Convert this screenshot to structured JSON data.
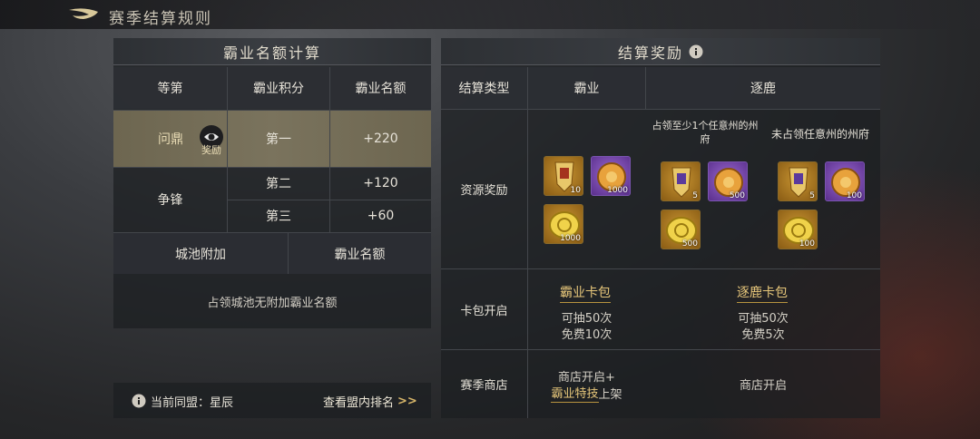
{
  "window": {
    "title": "赛季结算规则"
  },
  "left": {
    "header": "霸业名额计算",
    "columns": [
      "等第",
      "霸业积分",
      "霸业名额"
    ],
    "rows": [
      {
        "tier": "问鼎",
        "reward_label": "奖励",
        "rank": "第一",
        "quota": "+220"
      },
      {
        "tier": "争锋",
        "rank": "第二",
        "quota": "+120"
      },
      {
        "rank": "第三",
        "quota": "+60"
      }
    ],
    "city_header": [
      "城池附加",
      "霸业名额"
    ],
    "city_note": "占领城池无附加霸业名额",
    "alliance": "当前同盟：星辰",
    "view_rank": "查看盟内排名"
  },
  "right": {
    "header": "结算奖励",
    "columns": [
      "结算类型",
      "霸业",
      "逐鹿"
    ],
    "sub_a": "占领至少1个任意州的州府",
    "sub_b": "未占领任意州的州府",
    "row_labels": [
      "资源奖励",
      "卡包开启",
      "赛季商店"
    ],
    "baye_items": [
      {
        "icon": "banner-token-icon",
        "qty": "10"
      },
      {
        "icon": "jade-cookie-icon",
        "qty": "1000"
      },
      {
        "icon": "gold-coin-icon",
        "qty": "1000"
      }
    ],
    "zhulu_a_items": [
      {
        "icon": "banner-token-icon",
        "qty": "5"
      },
      {
        "icon": "jade-cookie-icon",
        "qty": "500"
      },
      {
        "icon": "gold-coin-icon",
        "qty": "500"
      }
    ],
    "zhulu_b_items": [
      {
        "icon": "banner-token-icon",
        "qty": "5"
      },
      {
        "icon": "jade-cookie-icon",
        "qty": "100"
      },
      {
        "icon": "gold-coin-icon",
        "qty": "100"
      }
    ],
    "baye_pack": {
      "name": "霸业卡包",
      "draws": "可抽50次",
      "free": "免费10次"
    },
    "zhulu_pack": {
      "name": "逐鹿卡包",
      "draws": "可抽50次",
      "free": "免费5次"
    },
    "baye_shop": {
      "line1": "商店开启+",
      "link": "霸业特技",
      "suffix": "上架"
    },
    "zhulu_shop": "商店开启"
  }
}
